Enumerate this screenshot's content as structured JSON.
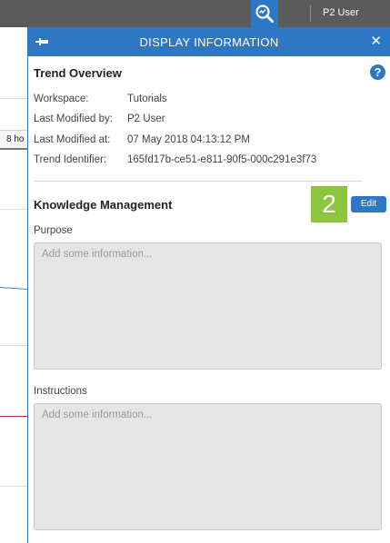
{
  "topbar": {
    "user_label": "P2 User",
    "search_icon": "search-analysis-icon"
  },
  "background": {
    "tab_label": "8 ho"
  },
  "panel": {
    "title": "DISPLAY INFORMATION",
    "pin_icon": "pin-icon",
    "close_symbol": "✕",
    "trend_overview": {
      "title": "Trend Overview",
      "help_symbol": "?",
      "rows": [
        {
          "label": "Workspace:",
          "value": "Tutorials"
        },
        {
          "label": "Last Modified by:",
          "value": "P2 User"
        },
        {
          "label": "Last Modified at:",
          "value": "07 May 2018 04:13:12 PM"
        },
        {
          "label": "Trend Identifier:",
          "value": "165fd17b-ce51-e811-90f5-000c291e3f73"
        }
      ]
    },
    "knowledge": {
      "title": "Knowledge Management",
      "step_badge": "2",
      "edit_label": "Edit",
      "purpose_label": "Purpose",
      "purpose_placeholder": "Add some information...",
      "instructions_label": "Instructions",
      "instructions_placeholder": "Add some information..."
    }
  },
  "colors": {
    "accent": "#2e77c5",
    "topbar": "#5b5b5b",
    "badge": "#8cc63f",
    "field_bg": "#e5e5e5"
  }
}
